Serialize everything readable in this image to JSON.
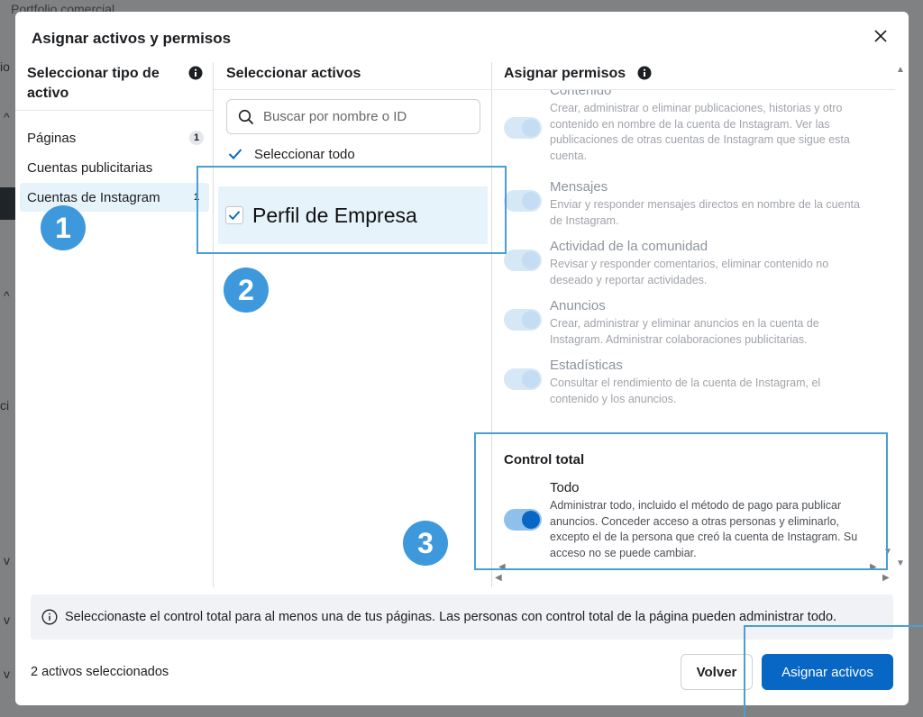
{
  "background": {
    "title": "Portfolio comercial",
    "glyphs": [
      "io",
      "^",
      "^",
      "ci",
      "v",
      "v",
      "v"
    ]
  },
  "modal": {
    "title": "Asignar activos y permisos",
    "close_icon": "close-icon"
  },
  "asset_types": {
    "heading": "Seleccionar tipo de activo",
    "items": [
      {
        "label": "Páginas",
        "badge": "1",
        "active": false
      },
      {
        "label": "Cuentas publicitarias",
        "badge": "",
        "active": false
      },
      {
        "label": "Cuentas de Instagram",
        "badge": "1",
        "active": true
      }
    ]
  },
  "assets": {
    "heading": "Seleccionar activos",
    "search_placeholder": "Buscar por nombre o ID",
    "select_all_label": "Seleccionar todo",
    "items": [
      {
        "label": "Perfil de Empresa",
        "checked": true
      }
    ]
  },
  "permissions": {
    "heading": "Asignar permisos",
    "items": [
      {
        "title": "Contenido",
        "description": "Crear, administrar o eliminar publicaciones, historias y otro contenido en nombre de la cuenta de Instagram. Ver las publicaciones de otras cuentas de Instagram que sigue esta cuenta."
      },
      {
        "title": "Mensajes",
        "description": "Enviar y responder mensajes directos en nombre de la cuenta de Instagram."
      },
      {
        "title": "Actividad de la comunidad",
        "description": "Revisar y responder comentarios, eliminar contenido no deseado y reportar actividades."
      },
      {
        "title": "Anuncios",
        "description": "Crear, administrar y eliminar anuncios en la cuenta de Instagram. Administrar colaboraciones publicitarias."
      },
      {
        "title": "Estadísticas",
        "description": "Consultar el rendimiento de la cuenta de Instagram, el contenido y los anuncios."
      }
    ],
    "full_control": {
      "heading": "Control total",
      "title": "Todo",
      "description": "Administrar todo, incluido el método de pago para publicar anuncios. Conceder acceso a otras personas y eliminarlo, excepto el de la persona que creó la cuenta de Instagram. Su acceso no se puede cambiar.",
      "enabled": true
    }
  },
  "banner": {
    "text": "Seleccionaste el control total para al menos una de tus páginas. Las personas con control total de la página pueden administrar todo."
  },
  "footer": {
    "count_text": "2 activos seleccionados",
    "back_label": "Volver",
    "assign_label": "Asignar activos"
  },
  "annotations": {
    "steps": [
      "1",
      "2",
      "3"
    ],
    "color": "#3d99dc"
  },
  "colors": {
    "primary": "#0866c4",
    "selected_bg": "#e7f3fb"
  }
}
